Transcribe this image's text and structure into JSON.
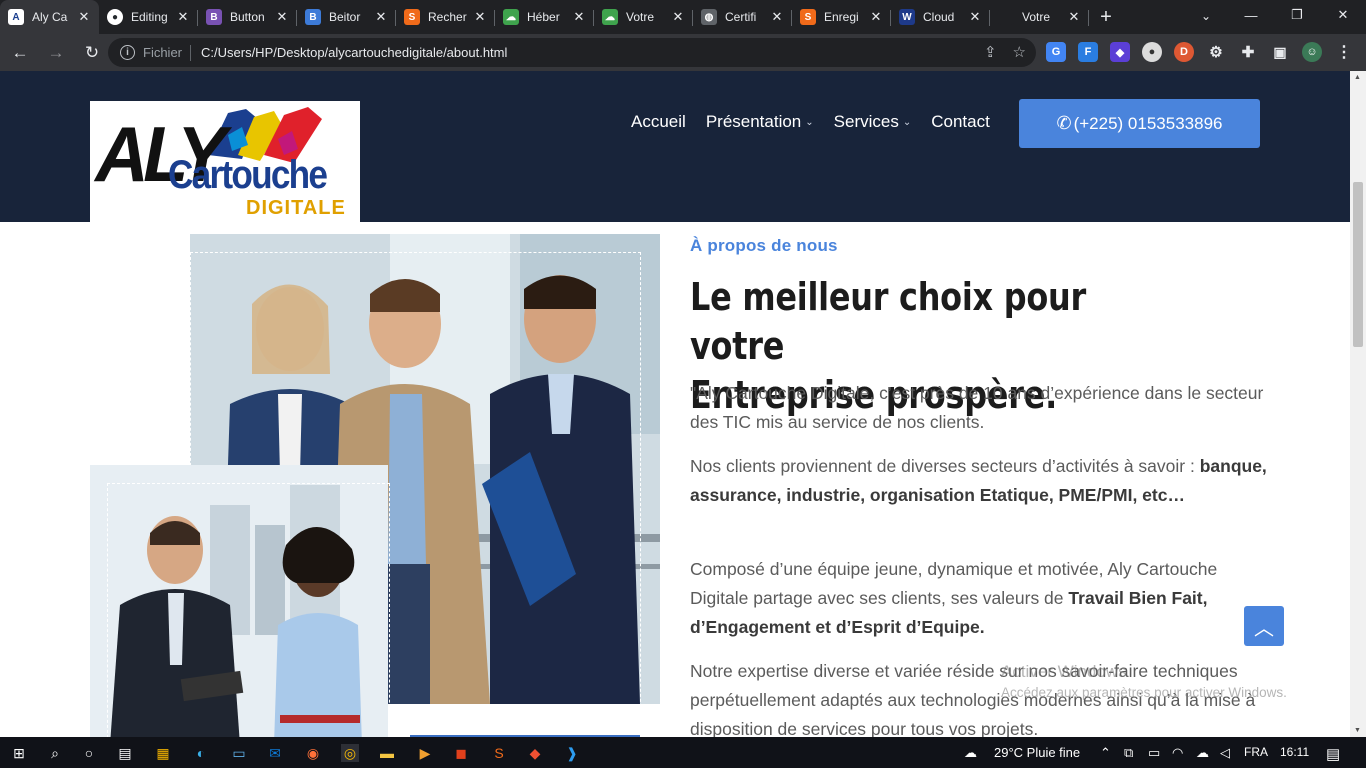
{
  "browser": {
    "tabs": [
      {
        "label": "Aly Ca",
        "favicon": "aly-favicon",
        "color": "#ffffff",
        "active": true
      },
      {
        "label": "Editing",
        "favicon": "github-icon",
        "color": "#24292e"
      },
      {
        "label": "Button",
        "favicon": "bootstrap-icon",
        "color": "#7952b3",
        "glyph": "B"
      },
      {
        "label": "Beitor",
        "favicon": "bootstrap-blue-icon",
        "color": "#3d7bd8",
        "glyph": "B"
      },
      {
        "label": "Recher",
        "favicon": "sublime-icon",
        "color": "#f06a1a",
        "glyph": "S"
      },
      {
        "label": "Héber",
        "favicon": "cloud-icon",
        "color": "#3fa34d",
        "glyph": "☁"
      },
      {
        "label": "Votre",
        "favicon": "cloud-icon",
        "color": "#3fa34d",
        "glyph": "☁"
      },
      {
        "label": "Certifi",
        "favicon": "globe-icon",
        "color": "#5f6368",
        "glyph": "◍"
      },
      {
        "label": "Enregi",
        "favicon": "sublime-icon",
        "color": "#f06a1a",
        "glyph": "S"
      },
      {
        "label": "Cloud",
        "favicon": "cloudflare-icon",
        "color": "#1e3a8a",
        "glyph": "W"
      },
      {
        "label": "Votre",
        "favicon": "blank-icon",
        "color": "#202124",
        "glyph": ""
      }
    ],
    "new_tab": "+",
    "window_controls": {
      "minimize": "—",
      "maximize": "❐",
      "close": "✕"
    },
    "tab_search": "⌄",
    "url_scheme": "Fichier",
    "url": "C:/Users/HP/Desktop/alycartouchedigitale/about.html"
  },
  "site": {
    "nav": [
      {
        "label": "Accueil",
        "dropdown": false
      },
      {
        "label": "Présentation",
        "dropdown": true
      },
      {
        "label": "Services",
        "dropdown": true
      },
      {
        "label": "Contact",
        "dropdown": false
      }
    ],
    "phone": "(+225) 0153533896",
    "logo": {
      "part1": "ALY",
      "part2": "Cartouche",
      "part3": "DIGITALE"
    }
  },
  "about": {
    "eyebrow": "À propos de nous",
    "headline_line1": "Le meilleur choix pour votre",
    "headline_line2": "Entreprise prospère.",
    "p1": "\"Aly Cartouche Digitale, c’est près de 10 ans d’expérience dans le secteur des TIC mis au service de nos clients.",
    "p2_text": "Nos clients proviennent de diverses secteurs d’activités à savoir :",
    "p2_bold": "banque, assurance, industrie, organisation Etatique, PME/PMI, etc…",
    "p3_text": "Composé d’une équipe jeune, dynamique et motivée, Aly Cartouche Digitale partage avec ses clients, ses valeurs de",
    "p3_bold": "Travail Bien Fait, d’Engagement et d’Esprit d’Equipe.",
    "p4": "Notre expertise diverse et variée réside sur nos savoir-faire techniques perpétuellement adaptés aux technologies modernes ainsi qu’à la mise à disposition de services pour tous vos projets."
  },
  "windows_activation": {
    "title": "Activer Windows",
    "subtitle": "Accédez aux paramètres pour activer Windows."
  },
  "taskbar": {
    "weather": "29°C  Pluie fine",
    "language": "FRA",
    "time": "16:11"
  },
  "colors": {
    "header_bg": "#18243a",
    "accent": "#4a84dc",
    "headline": "#1c1c1c",
    "body_text": "#5b5b5b"
  }
}
